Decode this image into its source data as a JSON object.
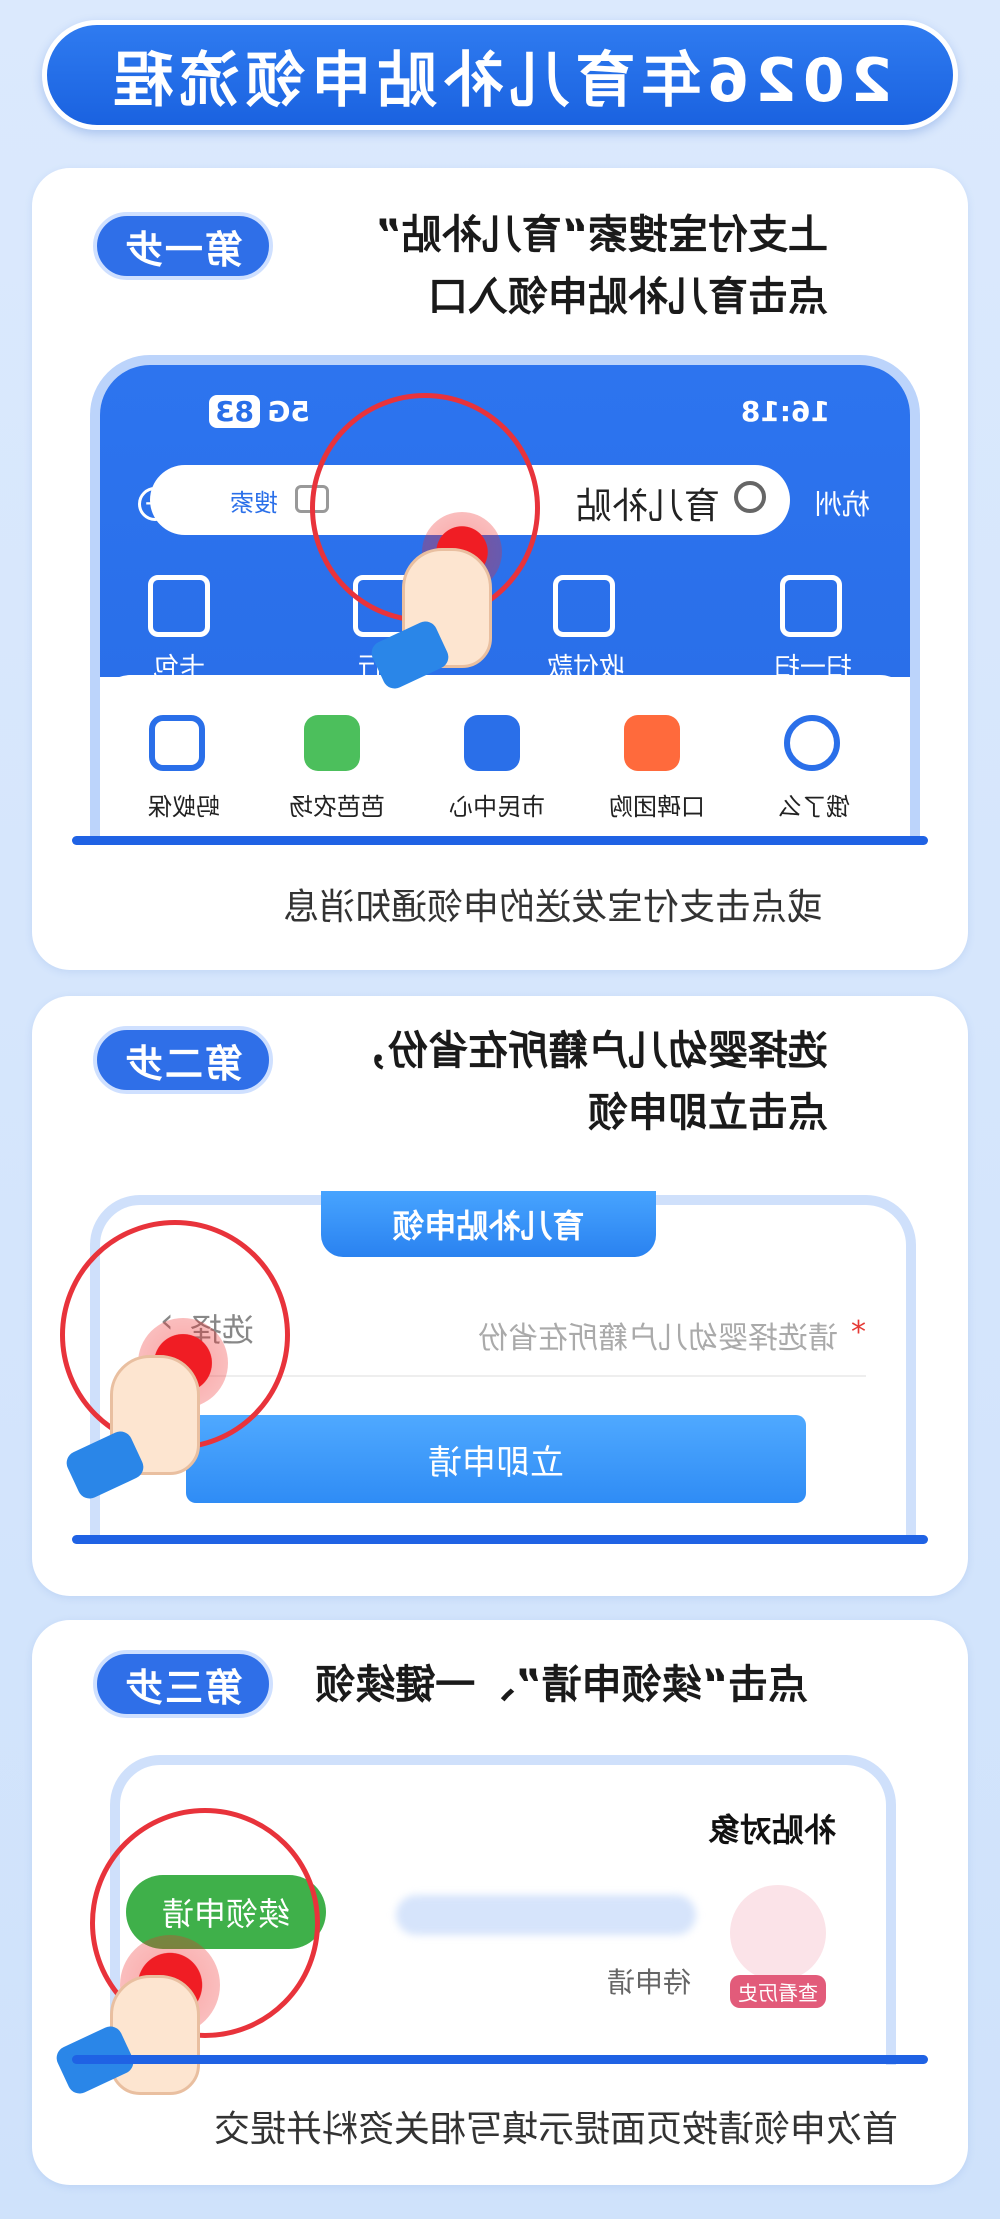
{
  "title": "2026年育儿补贴申领流程",
  "steps": [
    {
      "badge": "第一步",
      "line1": "上支付宝搜索“育儿补贴”",
      "line2": "点击育儿补贴申领入口",
      "caption": "或点击支付宝发送的申领通知消息",
      "phone": {
        "time": "16:18",
        "signal": "5G",
        "battery": "83",
        "city": "杭州",
        "search_query": "育儿补贴",
        "search_button": "搜索",
        "quick_actions": [
          "扫一扫",
          "收付款",
          "出行",
          "卡包"
        ],
        "apps": [
          "饿了么",
          "口碑团购",
          "市民中心",
          "芭芭农场",
          "蚂蚁保"
        ]
      }
    },
    {
      "badge": "第二步",
      "line1": "选择婴幼儿户籍所在省份，",
      "line2": "点击立即申领",
      "form": {
        "tab": "育儿补贴申领",
        "field_placeholder": "请选择婴幼儿户籍所在省份",
        "field_required": "*",
        "select_label": "选择",
        "submit": "立即申请"
      }
    },
    {
      "badge": "第三步",
      "line1": "点击“续领申请”、一键续领",
      "caption": "首次申领请按页面提示填写相关资料并提交",
      "form": {
        "heading": "补贴对象",
        "status": "待申请",
        "avatar_label": "查看历史",
        "renew": "续领申请"
      }
    }
  ]
}
